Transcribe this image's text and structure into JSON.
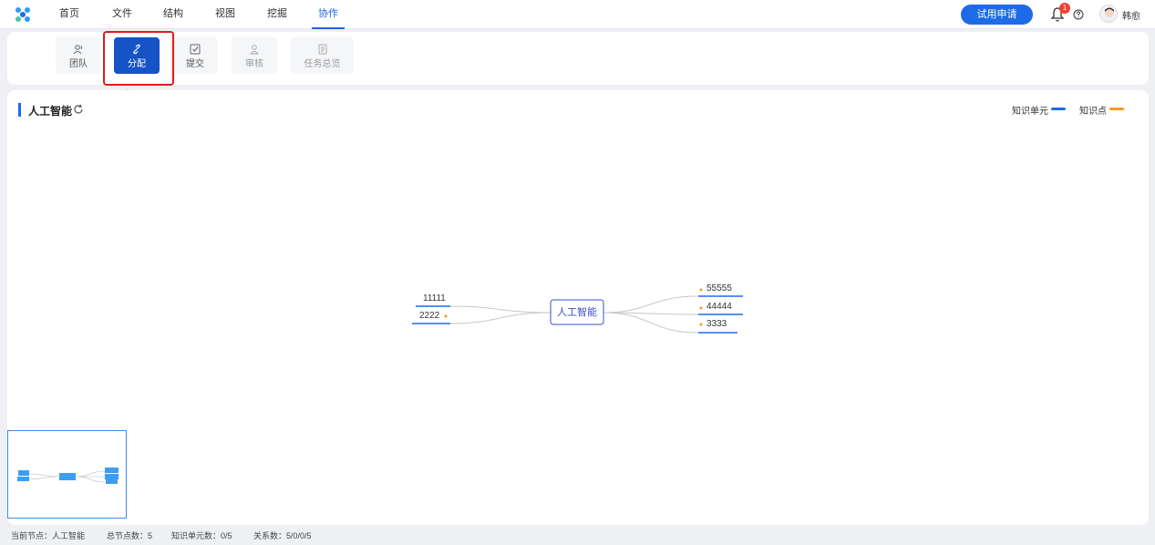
{
  "nav": {
    "items": [
      {
        "label": "首页"
      },
      {
        "label": "文件"
      },
      {
        "label": "结构"
      },
      {
        "label": "视图"
      },
      {
        "label": "挖掘"
      },
      {
        "label": "协作"
      }
    ],
    "active": "协作",
    "trial_button": "试用申请",
    "notification_count": "1",
    "username": "韩愈"
  },
  "toolbar": {
    "tools": [
      {
        "label": "团队",
        "icon": "team-icon",
        "state": "normal"
      },
      {
        "label": "分配",
        "icon": "link-icon",
        "state": "active"
      },
      {
        "label": "提交",
        "icon": "checkbox-icon",
        "state": "normal"
      },
      {
        "label": "审核",
        "icon": "reviewer-icon",
        "state": "disabled"
      },
      {
        "label": "任务总览",
        "icon": "document-icon",
        "state": "disabled"
      }
    ]
  },
  "map": {
    "title": "人工智能",
    "legend": [
      {
        "label": "知识单元",
        "color": "#1e6be8"
      },
      {
        "label": "知识点",
        "color": "#f59a23"
      }
    ],
    "root": "人工智能",
    "left_nodes": [
      "11111",
      "2222"
    ],
    "right_nodes": [
      "55555",
      "44444",
      "3333"
    ]
  },
  "status": {
    "current_node": "当前节点：人工智能",
    "total_nodes": "总节点数：5",
    "knowledge_units": "知识单元数：0/5",
    "relations": "关系数：5/0/0/5"
  },
  "colors": {
    "accent": "#1e6be8",
    "active_tool": "#1553c6",
    "highlight": "#e21b1b",
    "badge": "#f04134",
    "point_dot": "#f59a23"
  }
}
